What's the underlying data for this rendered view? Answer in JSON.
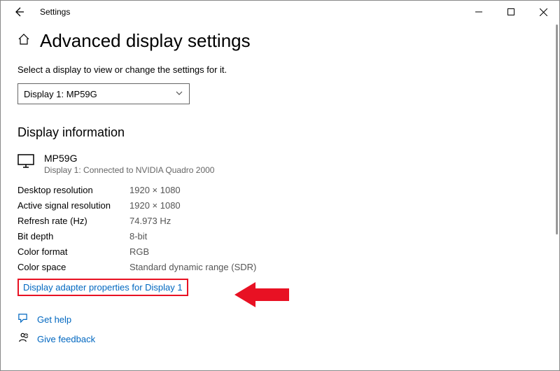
{
  "titlebar": {
    "title": "Settings"
  },
  "page": {
    "heading": "Advanced display settings",
    "instruction": "Select a display to view or change the settings for it.",
    "dropdownValue": "Display 1: MP59G",
    "sectionHeading": "Display information",
    "monitor": {
      "name": "MP59G",
      "sub": "Display 1: Connected to NVIDIA Quadro 2000"
    },
    "rows": [
      {
        "label": "Desktop resolution",
        "value": "1920 × 1080"
      },
      {
        "label": "Active signal resolution",
        "value": "1920 × 1080"
      },
      {
        "label": "Refresh rate (Hz)",
        "value": "74.973 Hz"
      },
      {
        "label": "Bit depth",
        "value": "8-bit"
      },
      {
        "label": "Color format",
        "value": "RGB"
      },
      {
        "label": "Color space",
        "value": "Standard dynamic range (SDR)"
      }
    ],
    "adapterLink": "Display adapter properties for Display 1",
    "footer": {
      "help": "Get help",
      "feedback": "Give feedback"
    }
  }
}
